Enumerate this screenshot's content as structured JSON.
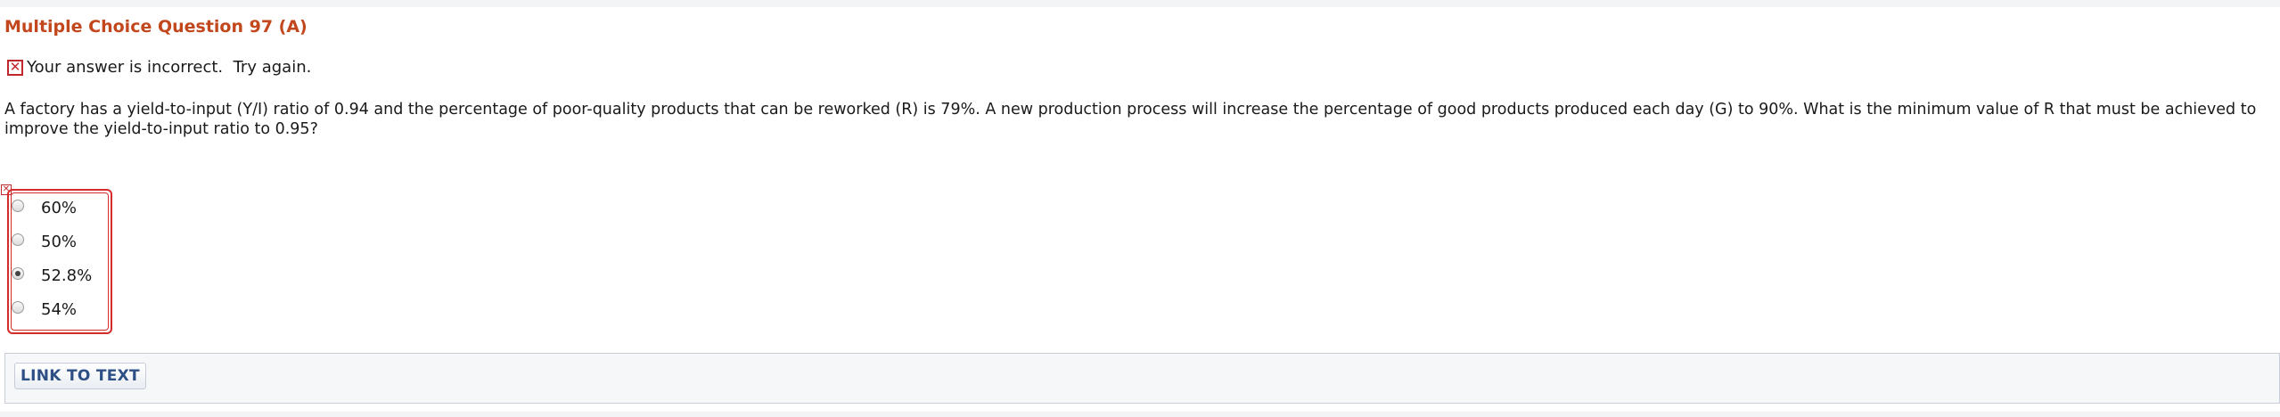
{
  "question": {
    "title": "Multiple Choice Question 97 (A)",
    "feedback": "Your answer is incorrect.  Try again.",
    "text": "A factory has a yield-to-input (Y/I) ratio of 0.94 and the percentage of poor-quality products that can be reworked (R) is 79%. A new production process will increase the percentage of good products produced each day (G) to 90%. What is the minimum value of R that must be achieved to improve the yield-to-input ratio to 0.95?"
  },
  "choices": [
    {
      "label": "60%",
      "selected": false
    },
    {
      "label": "50%",
      "selected": false
    },
    {
      "label": "52.8%",
      "selected": true
    },
    {
      "label": "54%",
      "selected": false
    }
  ],
  "link_panel": {
    "button_label": "LINK TO TEXT"
  },
  "colors": {
    "title": "#c3471d",
    "error": "#d42c2c",
    "link": "#2d4f86"
  },
  "icons": {
    "feedback_icon": "incorrect-x-icon",
    "choices_marker": "incorrect-x-icon"
  }
}
